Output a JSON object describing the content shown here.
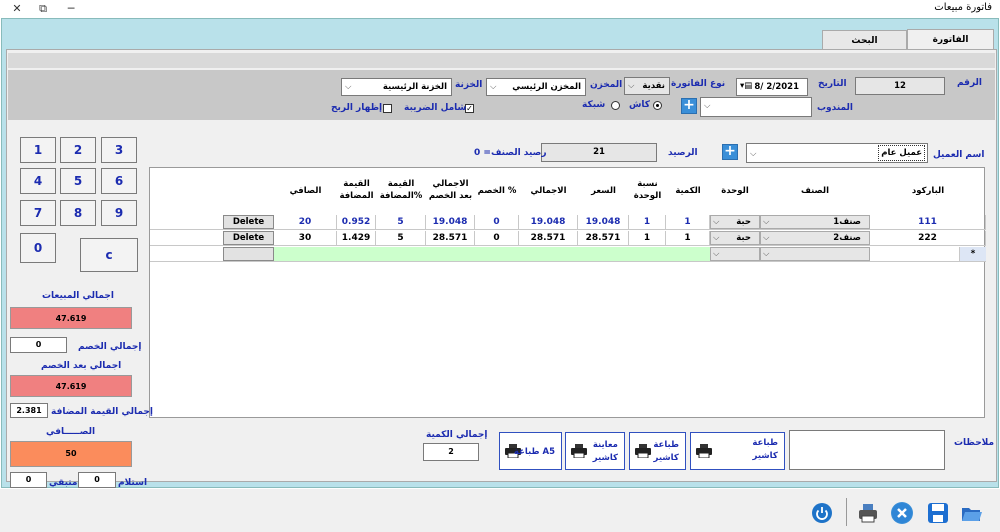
{
  "window": {
    "title": "فاتورة مبيعات"
  },
  "tabs": [
    {
      "label": "الفاتورة",
      "active": true
    },
    {
      "label": "البحث",
      "active": false
    }
  ],
  "header": {
    "number_label": "الرقم",
    "number_value": "12",
    "date_label": "التاريخ",
    "date_value": "8/ 2/2021",
    "invoice_type_label": "نوع الفاتورة",
    "invoice_type_value": "نقدية",
    "store_label": "المخزن",
    "store_value": "المخزن الرئيسي",
    "safe_label": "الخزنة",
    "safe_value": "الخزنة الرئيسية",
    "rep_label": "المندوب",
    "pay_cash": "كاش",
    "pay_network": "شبكة",
    "tax_included": "شامل الضريبة",
    "show_profit": "إظهار الربح"
  },
  "customer": {
    "label": "اسم العميل",
    "value": "عميل عام",
    "balance_label": "الرصيد",
    "balance_value": "21",
    "item_balance": "رصيد الصنف= 0"
  },
  "keypad": [
    "1",
    "2",
    "3",
    "4",
    "5",
    "6",
    "7",
    "8",
    "9",
    "0",
    "c"
  ],
  "grid": {
    "columns": [
      "الباركود",
      "الصنف",
      "الوحدة",
      "الكمية",
      "نسبة الوحدة",
      "السعر",
      "الاجمالي",
      "الخصم %",
      "الاجمالي بعد الخصم",
      "القيمة المضافة%",
      "القيمة المضافة",
      "الصافي"
    ],
    "rows": [
      {
        "barcode": "111",
        "item": "صنف1",
        "unit": "حبة",
        "qty": "1",
        "ratio": "1",
        "price": "19.048",
        "total": "19.048",
        "discount": "0",
        "after_discount": "19.048",
        "vat_pct": "5",
        "vat": "0.952",
        "net": "20",
        "action": "Delete"
      },
      {
        "barcode": "222",
        "item": "صنف2",
        "unit": "حبة",
        "qty": "1",
        "ratio": "1",
        "price": "28.571",
        "total": "28.571",
        "discount": "0",
        "after_discount": "28.571",
        "vat_pct": "5",
        "vat": "1.429",
        "net": "30",
        "action": "Delete"
      }
    ],
    "new_row_marker": "*"
  },
  "totals": {
    "sales_label": "اجمالي المبيعات",
    "sales_value": "47.619",
    "discount_label": "إجمالي الخصم",
    "discount_value": "0",
    "after_discount_label": "اجمالي بعد الخصم",
    "after_discount_value": "47.619",
    "vat_label": "إجمالي القيمة المضافة",
    "vat_value": "2.381",
    "net_label": "الصـــــافي",
    "net_value": "50",
    "received_label": "استلام",
    "received_value": "0",
    "remaining_label": "متبقي",
    "remaining_value": "0",
    "qty_label": "إجمالي الكمية",
    "qty_value": "2"
  },
  "notes_label": "ملاحظات",
  "print_buttons": [
    {
      "line1": "طباعة",
      "line2": "كاشير"
    },
    {
      "line1": "طباعة",
      "line2": "كاشير"
    },
    {
      "line1": "معاينة",
      "line2": "كاشير"
    },
    {
      "line1": "طباعة A5",
      "line2": ""
    }
  ],
  "colors": {
    "label_blue": "#1c2cb0",
    "red_total": "#f08080",
    "orange_net": "#fb8c5c",
    "frame": "#b9e1ea"
  }
}
